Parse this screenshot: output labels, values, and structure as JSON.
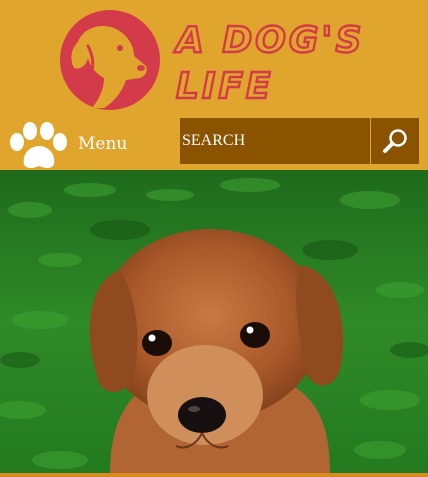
{
  "site": {
    "logo_line1": "A DOG'S",
    "logo_line2": "LIFE",
    "logo_icon": "dog-head-icon"
  },
  "nav": {
    "menu_icon": "paw-icon",
    "menu_label": "Menu",
    "search_placeholder": "SEARCH",
    "search_icon": "magnifier-icon"
  },
  "hero": {
    "image": "puppy-on-grass-photo"
  },
  "colors": {
    "background": "#e0a52c",
    "brand_red": "#d33a4a",
    "search_bg": "#8a5300"
  }
}
